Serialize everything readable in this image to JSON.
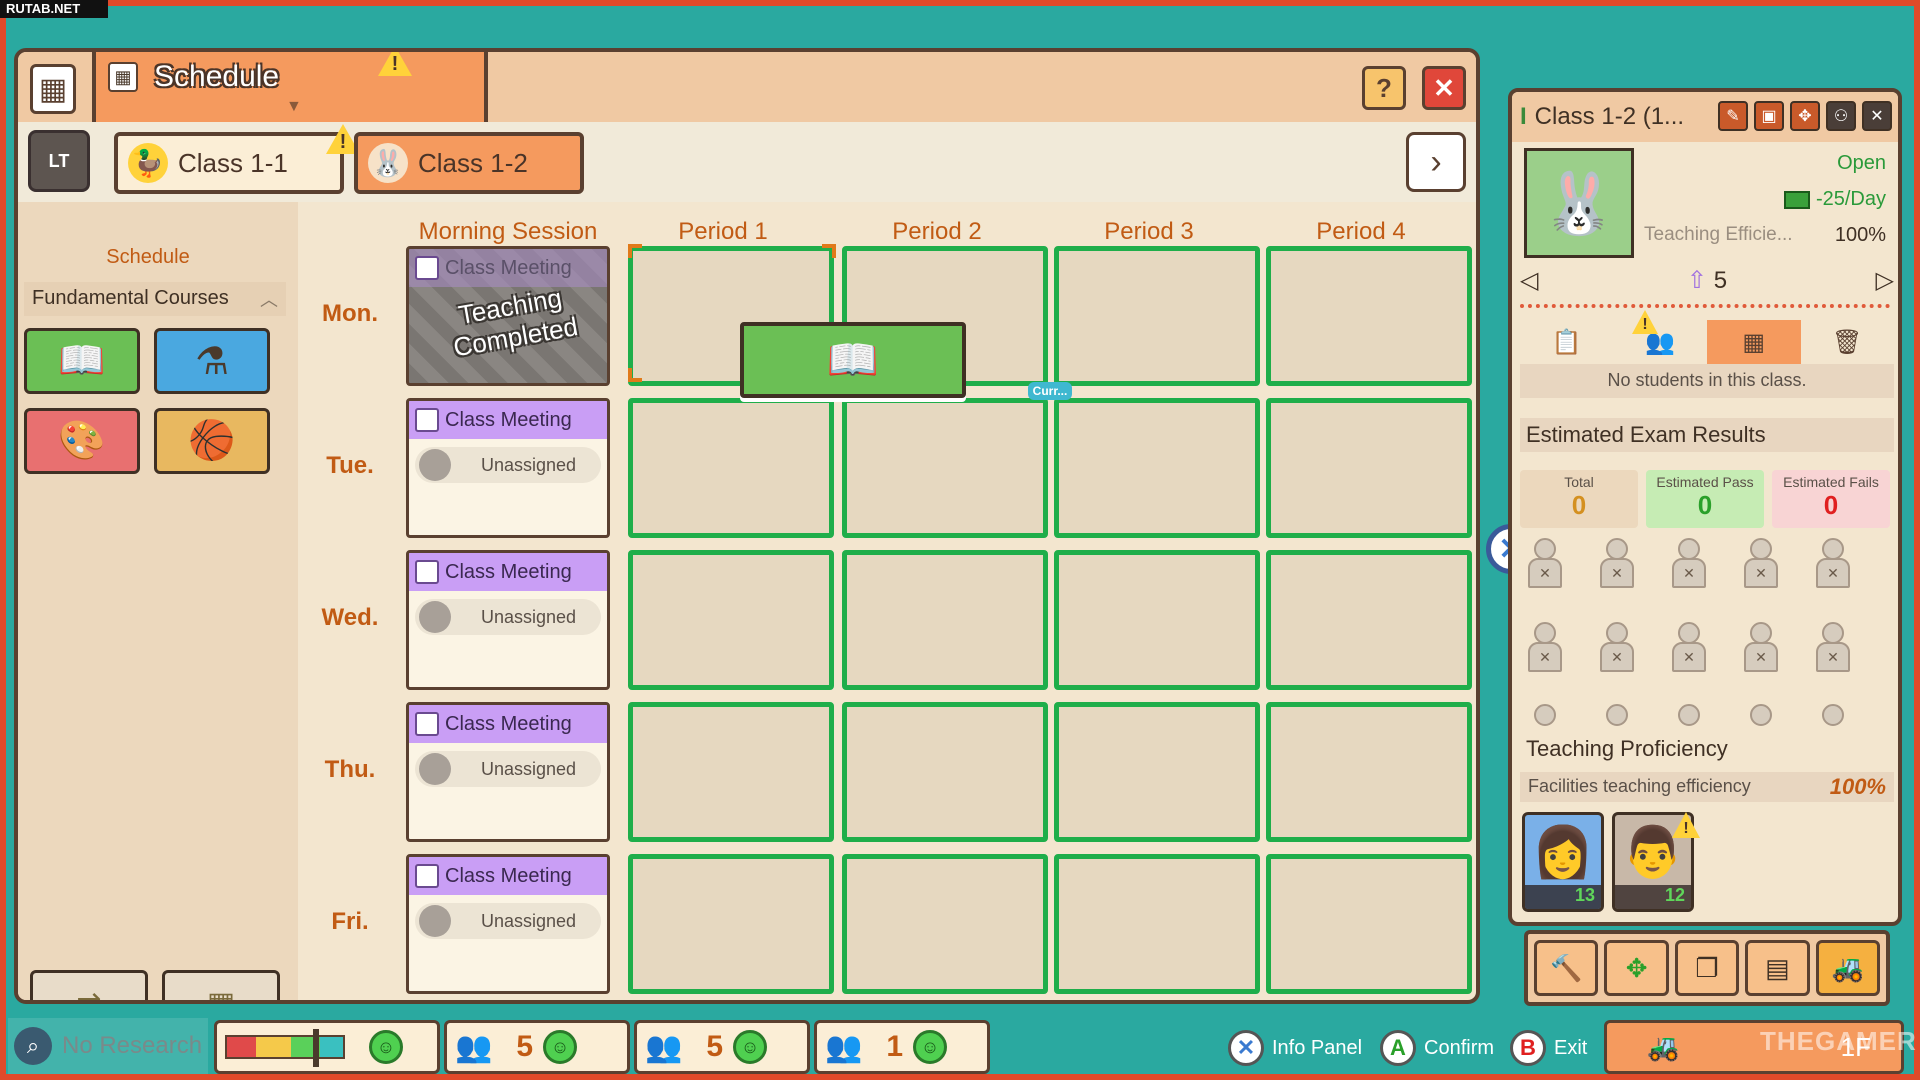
{
  "watermark": "RUTAB.NET",
  "watermark_bottom": "THEGAMER",
  "window": {
    "title": "Schedule",
    "help_label": "?",
    "close_label": "✕"
  },
  "classes": [
    {
      "label": "Class 1-1",
      "animal": "duck-icon",
      "warning": true
    },
    {
      "label": "Class 1-2",
      "animal": "bunny-icon",
      "active": true
    }
  ],
  "sidebar": {
    "heading": "Schedule",
    "section": "Fundamental Courses",
    "courses": [
      "book-icon",
      "flask-icon",
      "palette-icon",
      "basketball-icon"
    ]
  },
  "grid": {
    "columns": [
      "Morning Session",
      "Period 1",
      "Period 2",
      "Period 3",
      "Period 4"
    ],
    "days": [
      "Mon.",
      "Tue.",
      "Wed.",
      "Thu.",
      "Fri."
    ],
    "morning": {
      "mon": {
        "title": "Class Meeting",
        "overlay": "Teaching Completed"
      },
      "tue": {
        "title": "Class Meeting",
        "status": "Unassigned"
      },
      "wed": {
        "title": "Class Meeting",
        "status": "Unassigned"
      },
      "thu": {
        "title": "Class Meeting",
        "status": "Unassigned"
      },
      "fri": {
        "title": "Class Meeting",
        "status": "Unassigned"
      }
    },
    "current_tag": "Curr..."
  },
  "info_panel": {
    "title": "Class 1-2 (1...",
    "status": "Open",
    "cost": "-25/Day",
    "efficiency_label": "Teaching Efficie...",
    "efficiency_value": "100%",
    "level": "5",
    "no_students": "No students in this class.",
    "exam_title": "Estimated Exam Results",
    "exam": {
      "total_label": "Total",
      "total_value": "0",
      "pass_label": "Estimated Pass",
      "pass_value": "0",
      "fail_label": "Estimated Fails",
      "fail_value": "0"
    },
    "proficiency_title": "Teaching Proficiency",
    "proficiency_label": "Facilities teaching efficiency",
    "proficiency_value": "100%",
    "teachers": [
      {
        "level": "13"
      },
      {
        "level": "12"
      }
    ]
  },
  "status_bar": {
    "research": "No Research",
    "count_1": "5",
    "count_2": "5",
    "count_3": "1",
    "hint_info": "Info Panel",
    "hint_confirm": "Confirm",
    "hint_exit": "Exit",
    "floor": "1F"
  },
  "colors": {
    "accent": "#f59a5e",
    "slot_border": "#1fae4a",
    "class_meeting": "#c99ef5"
  }
}
